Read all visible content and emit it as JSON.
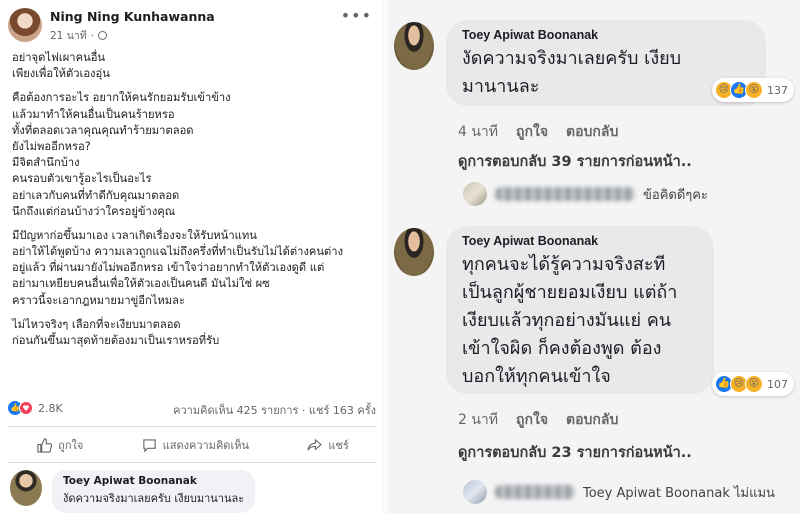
{
  "left_post": {
    "author": "Ning Ning Kunhawanna",
    "time": "21 นาที",
    "privacy_icon": "globe-icon",
    "more_icon": "ellipsis-icon",
    "paragraphs": [
      [
        "อย่าจุดไฟเผาคนอื่น",
        "เพียงเพื่อให้ตัวเองอุ่น"
      ],
      [
        "คือต้องการอะไร อยากให้คนรักยอมรับเข้าข้าง",
        "แล้วมาทำให้คนอื่นเป็นคนร้ายหรอ",
        "ทั้งที่ตลอดเวลาคุณคุณทำร้ายมาตลอด",
        "ยังไม่พออีกหรอ?",
        "มีจิตสำนึกบ้าง",
        "คนรอบตัวเขารู้อะไรเป็นอะไร",
        "อย่าเลวกับคนที่ทำดีกับคุณมาตลอด",
        "นึกถึงแต่ก่อนบ้างว่าใครอยู่ข้างคุณ"
      ],
      [
        "มีปัญหาก่อขึ้นมาเอง เวลาเกิดเรื่องจะให้รับหน้าแทน",
        "อย่าให้ได้พูดบ้าง ความเลวถูกแฉไม่ถึงครึ่งที่ทำเป็นรับไม่ได้ต่างคนต่าง",
        "อยู่แล้ว ที่ผ่านมายังไม่พออีกหรอ เข้าใจว่าอยากทำให้ตัวเองดูดี แต่",
        "อย่ามาเหยียบคนอื่นเพื่อให้ตัวเองเป็นคนดี มันไม่ใช่ ผซ",
        "คราวนี้จะเอากฎหมายมาขู่อีกไหมละ"
      ],
      [
        "ไม่ไหวจริงๆ เลือกที่จะเงียบมาตลอด",
        "ก่อนกันขึ้นมาสุดท้ายต้องมาเป็นเราหรอที่รับ"
      ]
    ],
    "reaction_count": "2.8K",
    "comments_count": "ความคิดเห็น 425 รายการ",
    "shares_count": "แชร์ 163 ครั้ง",
    "actions": {
      "like": "ถูกใจ",
      "comment": "แสดงความคิดเห็น",
      "share": "แชร์"
    },
    "comment": {
      "author": "Toey Apiwat Boonanak",
      "text": "งัดความจริงมาเลยครับ เงียบมานานละ"
    }
  },
  "right_panel": {
    "comment1": {
      "author": "Toey Apiwat Boonanak",
      "lines": [
        "งัดความจริงมาเลยครับ เงียบ",
        "มานานละ"
      ],
      "reaction_count": "137",
      "time": "4 นาที",
      "like": "ถูกใจ",
      "reply": "ตอบกลับ",
      "view_more": "ดูการตอบกลับ 39 รายการก่อนหน้า..",
      "reply_preview_text": "ข้อคิดดีๆคะ"
    },
    "comment2": {
      "author": "Toey Apiwat Boonanak",
      "lines": [
        "ทุกคนจะได้รู้ความจริงสะที",
        "เป็นลูกผู้ชายยอมเงียบ แต่ถ้า",
        "เงียบแล้วทุกอย่างมันแย่ คน",
        "เข้าใจผิด ก็คงต้องพูด ต้อง",
        "บอกให้ทุกคนเข้าใจ"
      ],
      "reaction_count": "107",
      "time": "2 นาที",
      "like": "ถูกใจ",
      "reply": "ตอบกลับ",
      "view_more": "ดูการตอบกลับ 23 รายการก่อนหน้า..",
      "reply_preview_text": "Toey Apiwat Boonanak ไม่แมน"
    }
  },
  "colors": {
    "facebook_blue": "#1877f2",
    "love_red": "#f33e58",
    "emoji_yellow": "#f7b125"
  }
}
